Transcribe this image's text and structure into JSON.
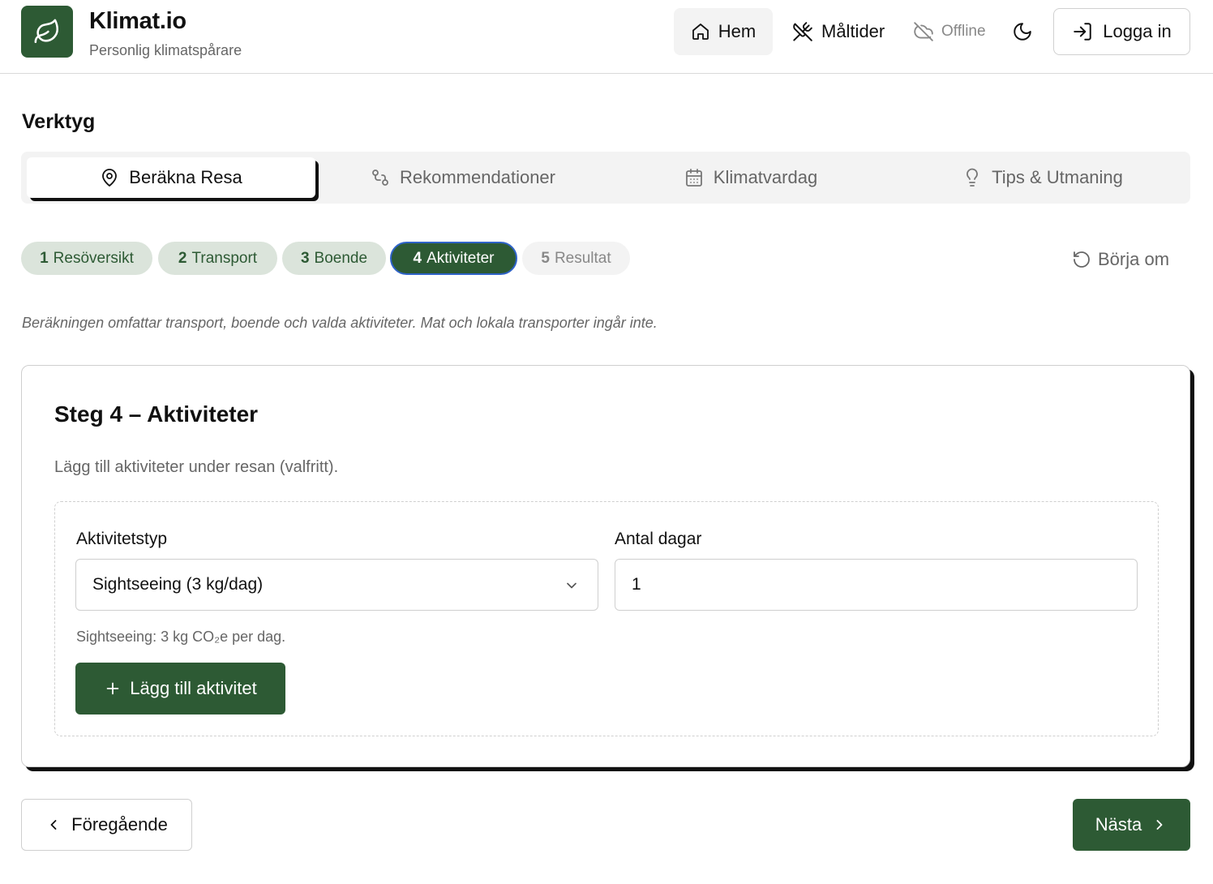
{
  "header": {
    "brand_title": "Klimat.io",
    "brand_subtitle": "Personlig klimatspårare",
    "nav": {
      "home_label": "Hem",
      "meals_label": "Måltider",
      "offline_label": "Offline",
      "login_label": "Logga in"
    }
  },
  "section": {
    "title": "Verktyg"
  },
  "tabs": [
    {
      "label": "Beräkna Resa",
      "icon": "map-pin-icon",
      "active": true
    },
    {
      "label": "Rekommendationer",
      "icon": "route-icon",
      "active": false
    },
    {
      "label": "Klimatvardag",
      "icon": "calendar-icon",
      "active": false
    },
    {
      "label": "Tips & Utmaning",
      "icon": "lightbulb-icon",
      "active": false
    }
  ],
  "steps": [
    {
      "number": "1",
      "label": "Resöversikt",
      "state": "done"
    },
    {
      "number": "2",
      "label": "Transport",
      "state": "done"
    },
    {
      "number": "3",
      "label": "Boende",
      "state": "done"
    },
    {
      "number": "4",
      "label": "Aktiviteter",
      "state": "current"
    },
    {
      "number": "5",
      "label": "Resultat",
      "state": "upcoming"
    }
  ],
  "restart_label": "Börja om",
  "note": "Beräkningen omfattar transport, boende och valda aktiviteter. Mat och lokala transporter ingår inte.",
  "card": {
    "title": "Steg 4 – Aktiviteter",
    "description": "Lägg till aktiviteter under resan (valfritt).",
    "activity_type_label": "Aktivitetstyp",
    "activity_type_value": "Sightseeing (3 kg/dag)",
    "days_label": "Antal dagar",
    "days_value": "1",
    "hint": "Sightseeing: 3 kg CO₂e per dag.",
    "add_button_label": "Lägg till aktivitet"
  },
  "footer": {
    "prev_label": "Föregående",
    "next_label": "Nästa"
  },
  "colors": {
    "brand_green": "#2d5a34",
    "step_done_bg": "#dbe4db",
    "focus_ring": "#2f63c8"
  }
}
